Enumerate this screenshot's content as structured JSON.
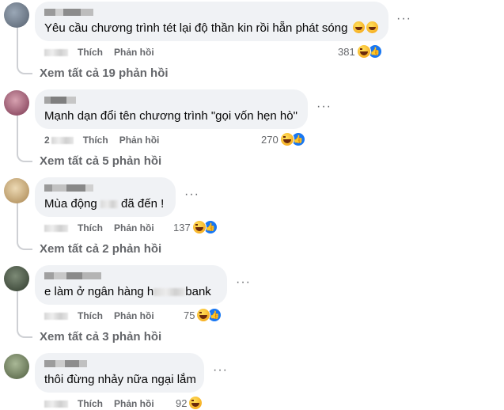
{
  "comments": [
    {
      "text": "Yêu cầu chương trình tét lại độ thần kin rồi hẵn phát sóng",
      "like_label": "Thích",
      "reply_label": "Phản hồi",
      "reaction_count": "381",
      "view_replies": "Xem tất cả 19 phản hồi",
      "avatar_color": "#6b7c8f"
    },
    {
      "text": "Mạnh dạn đổi tên chương trình \"gọi vốn hẹn hò\"",
      "like_label": "Thích",
      "reply_label": "Phản hồi",
      "time_prefix": "2",
      "reaction_count": "270",
      "view_replies": "Xem tất cả 5 phản hồi",
      "avatar_color": "#9c4a6a"
    },
    {
      "text_before": "Mùa động ",
      "text_after": " đã đến !",
      "like_label": "Thích",
      "reply_label": "Phản hồi",
      "reaction_count": "137",
      "view_replies": "Xem tất cả 2 phản hồi",
      "avatar_color": "#c9a97a"
    },
    {
      "text_before": "e làm ở ngân hàng h",
      "text_after": "bank",
      "like_label": "Thích",
      "reply_label": "Phản hồi",
      "reaction_count": "75",
      "view_replies": "Xem tất cả 3 phản hồi",
      "avatar_color": "#4a5a48"
    },
    {
      "text": "thôi đừng nhảy nữa ngại lắm",
      "like_label": "Thích",
      "reply_label": "Phản hồi",
      "reaction_count": "92",
      "avatar_color": "#7a8a6a"
    }
  ],
  "icons": {
    "more": "more-options-icon",
    "haha": "haha-reaction-icon",
    "like": "like-reaction-icon",
    "laugh_inline": "grinning-emoji-icon"
  },
  "colors": {
    "bubble": "#f0f2f5",
    "meta_text": "#65676b",
    "like_blue": "#1877f2"
  }
}
